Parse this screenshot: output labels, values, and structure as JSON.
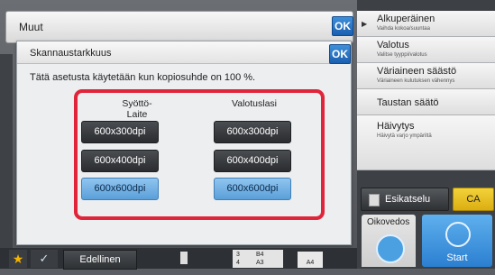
{
  "header": {
    "title": "Muut",
    "ok_label": "OK"
  },
  "dialog": {
    "title": "Skannaustarkkuus",
    "ok_label": "OK",
    "note": "Tätä asetusta käytetään kun kopiosuhde on 100 %.",
    "columns": [
      {
        "heading": "Syöttö-\nLaite",
        "options": [
          {
            "label": "600x300dpi",
            "selected": false
          },
          {
            "label": "600x400dpi",
            "selected": false
          },
          {
            "label": "600x600dpi",
            "selected": true
          }
        ]
      },
      {
        "heading": "Valotuslasi",
        "options": [
          {
            "label": "600x300dpi",
            "selected": false
          },
          {
            "label": "600x400dpi",
            "selected": false
          },
          {
            "label": "600x600dpi",
            "selected": true
          }
        ]
      }
    ]
  },
  "right_panel": {
    "items": [
      {
        "title": "Alkuperäinen",
        "subtitle": "Vaihda kokoa/suuntaa"
      },
      {
        "title": "Valotus",
        "subtitle": "Valitse tyyppi/valotus"
      },
      {
        "title": "Väriaineen säästö",
        "subtitle": "Väriaineen kulutuksen vähennys"
      },
      {
        "title": "Taustan säätö",
        "subtitle": ""
      },
      {
        "title": "Häivytys",
        "subtitle": "Häivytä varjo ympäriltä"
      }
    ],
    "preview_label": "Esikatselu",
    "ca_label": "CA",
    "copies_label": "Oikovedos",
    "start_label": "Start"
  },
  "bottom_bar": {
    "prev_label": "Edellinen",
    "pages": {
      "row1_left": "3",
      "row1_right": "B4",
      "row2_left": "4",
      "row2_right": "A3"
    },
    "paper_size": "A4"
  },
  "colors": {
    "accent": "#3f8fd8",
    "highlight": "#e0243a",
    "selected": "#8fc5f0",
    "ca": "#f2d23a"
  }
}
